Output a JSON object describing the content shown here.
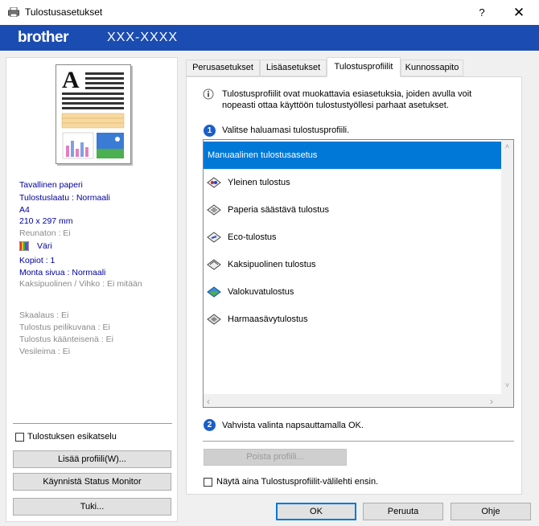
{
  "window": {
    "title": "Tulostusasetukset",
    "help": "?",
    "close": "✕"
  },
  "brand": {
    "logo": "brother",
    "model": "XXX-XXXX"
  },
  "left": {
    "info_blue": [
      "Tavallinen paperi",
      "Tulostuslaatu : Normaali",
      "A4",
      "210 x 297 mm"
    ],
    "borderless": "Reunaton : Ei",
    "color": "Väri",
    "copies": "Kopiot : 1",
    "multipage": "Monta sivua : Normaali",
    "duplex": "Kaksipuolinen / Vihko : Ei mitään",
    "gray_info": [
      "Skaalaus : Ei",
      "Tulostus peilikuvana : Ei",
      "Tulostus käänteisenä : Ei",
      "Vesileima : Ei"
    ],
    "preview_checkbox": "Tulostuksen esikatselu",
    "add_profile_button": "Lisää profiili(W)...",
    "status_monitor_button": "Käynnistä Status Monitor",
    "support_button": "Tuki..."
  },
  "tabs": [
    "Perusasetukset",
    "Lisäasetukset",
    "Tulostusprofiilit",
    "Kunnossapito"
  ],
  "main": {
    "description": "Tulostusprofiilit ovat muokattavia esiasetuksia, joiden avulla voit nopeasti ottaa käyttöön tulostustyöllesi parhaat asetukset.",
    "step1_num": "1",
    "step1_text": "Valitse haluamasi tulostusprofiili.",
    "profiles": [
      "Manuaalinen tulostusasetus",
      "Yleinen tulostus",
      "Paperia säästävä tulostus",
      "Eco-tulostus",
      "Kaksipuolinen tulostus",
      "Valokuvatulostus",
      "Harmaasävytulostus"
    ],
    "step2_num": "2",
    "step2_text": "Vahvista valinta napsauttamalla OK.",
    "delete_profile_button": "Poista profiili...",
    "always_show_checkbox": "Näytä aina Tulostusprofiilit-välilehti ensin."
  },
  "buttons": {
    "ok": "OK",
    "cancel": "Peruuta",
    "help": "Ohje"
  },
  "colors": {
    "brand_blue": "#1b4cb1",
    "selection": "#0078d7"
  }
}
